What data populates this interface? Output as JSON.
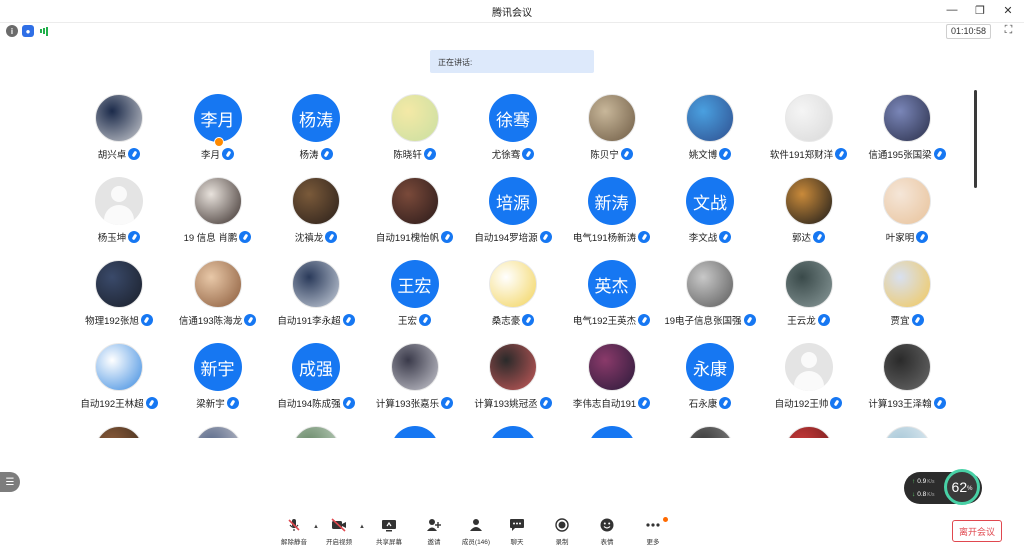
{
  "window": {
    "title": "腾讯会议",
    "timer": "01:10:58"
  },
  "speaking_label": "正在讲话:",
  "participants": [
    {
      "name": "胡兴卓",
      "avatar": "photo",
      "c1": "#1b2a4a",
      "c2": "#c9cbd0"
    },
    {
      "name": "李月",
      "avatar": "text",
      "text": "李月",
      "badge": true
    },
    {
      "name": "杨涛",
      "avatar": "text",
      "text": "杨涛"
    },
    {
      "name": "陈晓轩",
      "avatar": "photo",
      "c1": "#f4e9a6",
      "c2": "#c9dfa1"
    },
    {
      "name": "尤徐骞",
      "avatar": "text",
      "text": "徐骞"
    },
    {
      "name": "陈贝宁",
      "avatar": "photo",
      "c1": "#c8b79a",
      "c2": "#6e5b44"
    },
    {
      "name": "姚文博",
      "avatar": "photo",
      "c1": "#4aa0e0",
      "c2": "#2f4f8f"
    },
    {
      "name": "软件191郑财洋",
      "avatar": "photo",
      "c1": "#f5f5f5",
      "c2": "#d9d9d9"
    },
    {
      "name": "信通195张国梁",
      "avatar": "photo",
      "c1": "#7a86b8",
      "c2": "#2a2f4a"
    },
    {
      "name": "杨玉坤",
      "avatar": "placeholder"
    },
    {
      "name": "19 信息 肖鹏",
      "avatar": "photo",
      "c1": "#e8e2dc",
      "c2": "#3a2f2c"
    },
    {
      "name": "沈禛龙",
      "avatar": "photo",
      "c1": "#7a5a3a",
      "c2": "#2a1f1a"
    },
    {
      "name": "自动191槐怡帆",
      "avatar": "photo",
      "c1": "#7a4a3a",
      "c2": "#2a1a1a"
    },
    {
      "name": "自动194罗培源",
      "avatar": "text",
      "text": "培源"
    },
    {
      "name": "电气191杨新涛",
      "avatar": "text",
      "text": "新涛"
    },
    {
      "name": "李文战",
      "avatar": "text",
      "text": "文战"
    },
    {
      "name": "郭达",
      "avatar": "photo",
      "c1": "#c98a3a",
      "c2": "#1a1a1a"
    },
    {
      "name": "叶家明",
      "avatar": "photo",
      "c1": "#f5e6d8",
      "c2": "#e8c29a"
    },
    {
      "name": "物理192张旭",
      "avatar": "photo",
      "c1": "#3a4a6a",
      "c2": "#1a1f2a"
    },
    {
      "name": "信通193陈海龙",
      "avatar": "photo",
      "c1": "#e8c8a8",
      "c2": "#8a5a3a"
    },
    {
      "name": "自动191李永超",
      "avatar": "photo",
      "c1": "#2a3a5a",
      "c2": "#c8d0dc"
    },
    {
      "name": "王宏",
      "avatar": "text",
      "text": "王宏"
    },
    {
      "name": "桑志豪",
      "avatar": "photo",
      "c1": "#ffffff",
      "c2": "#f2d35a"
    },
    {
      "name": "电气192王英杰",
      "avatar": "text",
      "text": "英杰"
    },
    {
      "name": "19电子信息张国强",
      "avatar": "photo",
      "c1": "#c8c8c8",
      "c2": "#5a5a5a"
    },
    {
      "name": "王云龙",
      "avatar": "photo",
      "c1": "#3a4a4a",
      "c2": "#8a9a9a"
    },
    {
      "name": "贾宜",
      "avatar": "photo",
      "c1": "#d8e0f0",
      "c2": "#f2c85a"
    },
    {
      "name": "自动192王林超",
      "avatar": "photo",
      "c1": "#ffffff",
      "c2": "#3a8ae0"
    },
    {
      "name": "梁新宇",
      "avatar": "text",
      "text": "新宇"
    },
    {
      "name": "自动194陈成强",
      "avatar": "text",
      "text": "成强"
    },
    {
      "name": "计算193张嘉乐",
      "avatar": "photo",
      "c1": "#3a3a4a",
      "c2": "#c8c8d0"
    },
    {
      "name": "计算193姚冠丞",
      "avatar": "photo",
      "c1": "#2a2a2a",
      "c2": "#c85a5a"
    },
    {
      "name": "李伟志自动191",
      "avatar": "photo",
      "c1": "#8a3a6a",
      "c2": "#2a1a3a"
    },
    {
      "name": "石永康",
      "avatar": "text",
      "text": "永康"
    },
    {
      "name": "自动192王帅",
      "avatar": "placeholder"
    },
    {
      "name": "计算193王泽翰",
      "avatar": "photo",
      "c1": "#2a2a2a",
      "c2": "#6a6a6a"
    },
    {
      "name": "",
      "avatar": "photo",
      "c1": "#8a5a3a",
      "c2": "#3a2a1a"
    },
    {
      "name": "",
      "avatar": "photo",
      "c1": "#5a6a8a",
      "c2": "#c8c8d0"
    },
    {
      "name": "",
      "avatar": "photo",
      "c1": "#6a8a6a",
      "c2": "#c8d8c8"
    },
    {
      "name": "",
      "avatar": "text",
      "text": ""
    },
    {
      "name": "",
      "avatar": "text",
      "text": ""
    },
    {
      "name": "",
      "avatar": "text",
      "text": ""
    },
    {
      "name": "",
      "avatar": "photo",
      "c1": "#3a3a3a",
      "c2": "#8a8a8a"
    },
    {
      "name": "",
      "avatar": "photo",
      "c1": "#c83a3a",
      "c2": "#6a1a1a"
    },
    {
      "name": "",
      "avatar": "photo",
      "c1": "#a8c8d8",
      "c2": "#e8f0f5"
    }
  ],
  "network": {
    "up": "0.9",
    "down": "0.8",
    "unit": "K/s",
    "cpu": "62",
    "cpu_unit": "%"
  },
  "toolbar": {
    "unmute": "解除静音",
    "start_video": "开启视频",
    "share": "共享屏幕",
    "invite": "邀请",
    "members": "成员(146)",
    "chat": "聊天",
    "record": "录制",
    "emoji": "表情",
    "more": "更多",
    "leave": "离开会议"
  },
  "colors": {
    "accent": "#1677f2",
    "leave": "#e0484f",
    "cpu_ring": "#48d1a6"
  }
}
